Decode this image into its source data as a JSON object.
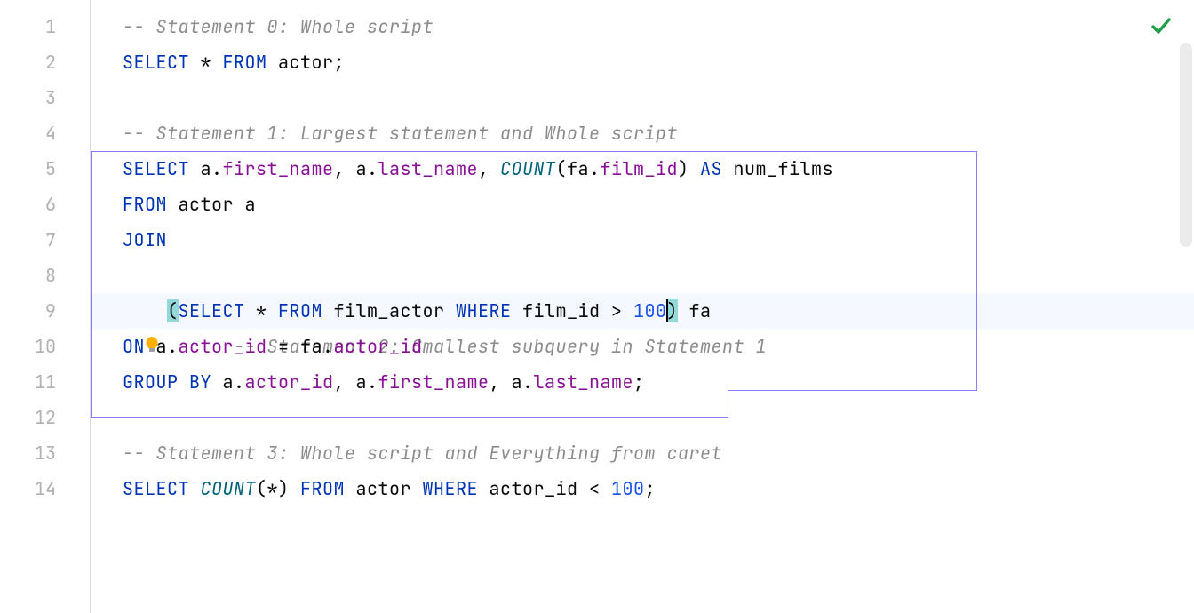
{
  "editor": {
    "lineCount": 14,
    "currentLine": 9,
    "lines": {
      "l1": {
        "c0": "-- Statement 0: Whole script"
      },
      "l2": {
        "kw0": "SELECT",
        "op0": " * ",
        "kw1": "FROM",
        "t0": " actor;"
      },
      "l3": {},
      "l4": {
        "c0": "-- Statement 1: Largest statement and Whole script"
      },
      "l5": {
        "kw0": "SELECT",
        "t0": " a.",
        "m0": "first_name",
        "t1": ", a.",
        "m1": "last_name",
        "t2": ", ",
        "fn0": "COUNT",
        "t3": "(fa.",
        "m2": "film_id",
        "t4": ") ",
        "kw1": "AS",
        "t5": " num_films"
      },
      "l6": {
        "kw0": "FROM",
        "t0": " actor a"
      },
      "l7": {
        "kw0": "JOIN"
      },
      "l8": {
        "pad": "    ",
        "c0": "-- Statement 2: Smallest subquery in Statement 1"
      },
      "l9": {
        "pad": "    ",
        "brL": "(",
        "kw0": "SELECT",
        "op0": " * ",
        "kw1": "FROM",
        "t0": " film_actor ",
        "kw2": "WHERE",
        "t1": " film_id > ",
        "num0": "100",
        "brR": ")",
        "t2": " fa"
      },
      "l10": {
        "kw0": "ON",
        "t0": " a.",
        "m0": "actor_id",
        "t1": " = fa.",
        "m1": "actor_id"
      },
      "l11": {
        "kw0": "GROUP BY",
        "t0": " a.",
        "m0": "actor_id",
        "t1": ", a.",
        "m1": "first_name",
        "t2": ", a.",
        "m2": "last_name",
        "t3": ";"
      },
      "l12": {},
      "l13": {
        "c0": "-- Statement 3: Whole script and Everything from caret"
      },
      "l14": {
        "kw0": "SELECT",
        "sp0": " ",
        "fn0": "COUNT",
        "t0": "(*) ",
        "kw1": "FROM",
        "t1": " actor ",
        "kw2": "WHERE",
        "t2": " actor_id < ",
        "num0": "100",
        "t3": ";"
      }
    }
  },
  "status": {
    "analysisOk": true
  }
}
